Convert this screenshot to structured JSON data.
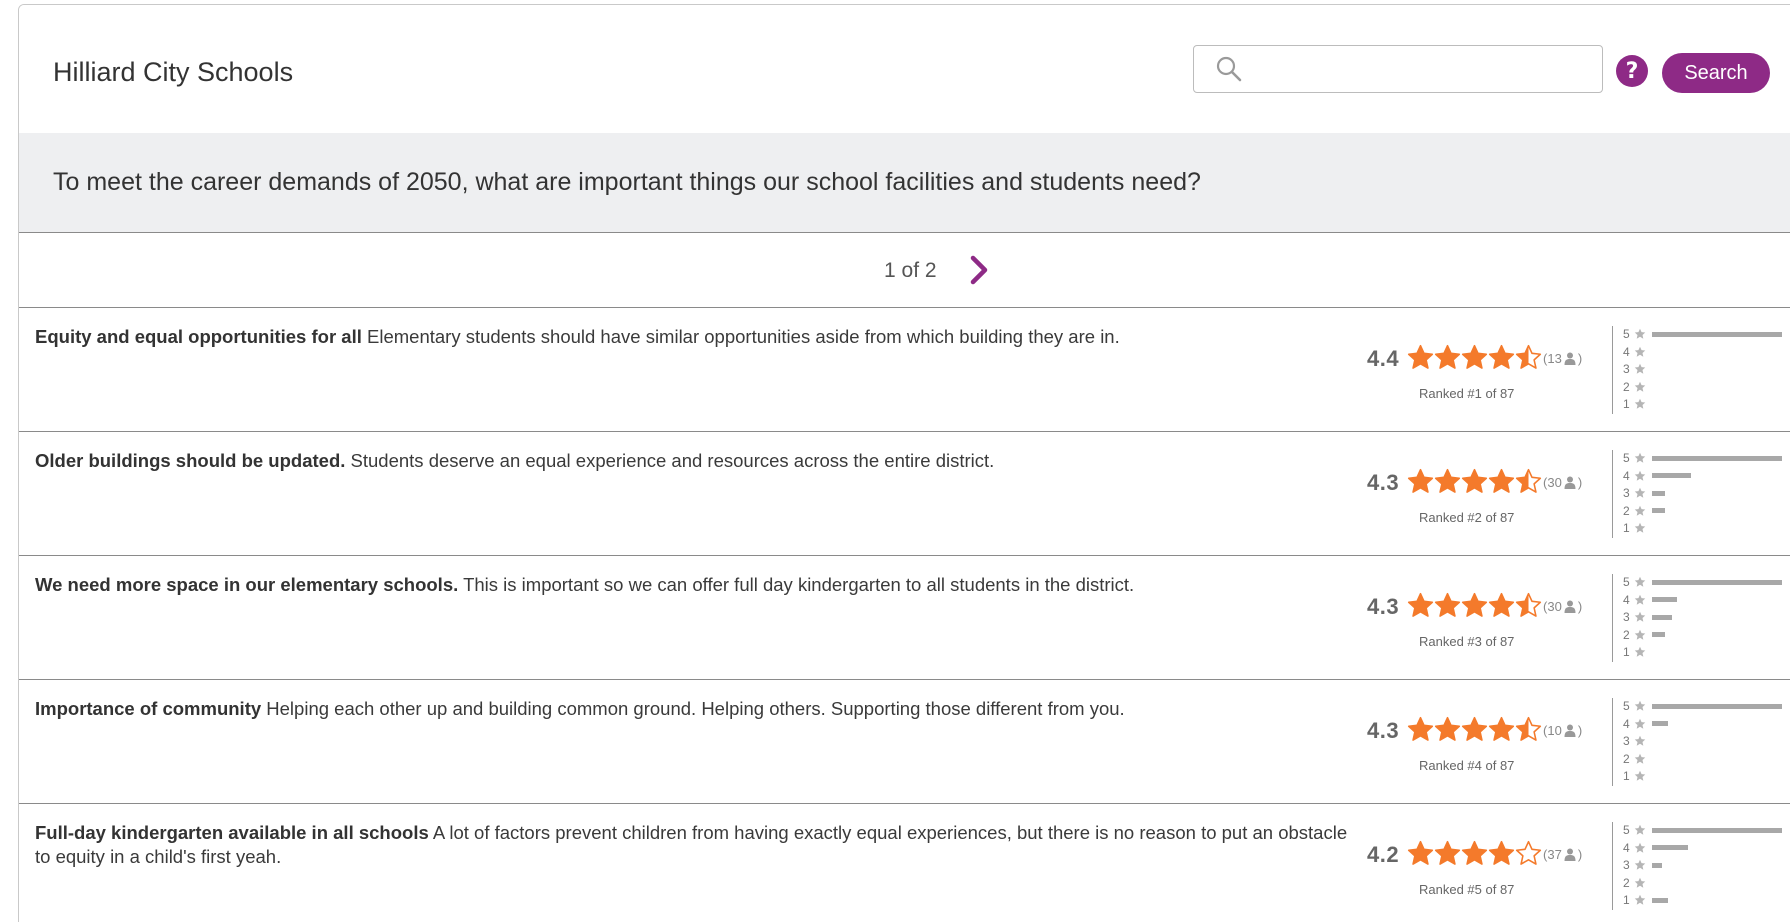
{
  "header": {
    "title": "Hilliard City Schools",
    "search_placeholder": "",
    "search_label": "Search",
    "help_label": "?"
  },
  "question": "To meet the career demands of 2050, what are important things our school facilities and students need?",
  "pager": {
    "label": "1 of 2"
  },
  "colors": {
    "accent": "#8e2a86",
    "star": "#f47a2b",
    "bar": "#a8a8a8"
  },
  "ideas": [
    {
      "title": "Equity and equal opportunities for all",
      "body": "Elementary students should have similar opportunities aside from which building they are in.",
      "score": "4.4",
      "stars": 4.5,
      "voters": "13",
      "ranked": "Ranked #1 of 87",
      "distribution": {
        "5": 1.0,
        "4": 0,
        "3": 0,
        "2": 0,
        "1": 0
      }
    },
    {
      "title": "Older buildings should be updated.",
      "body": "Students deserve an equal experience and resources across the entire district.",
      "score": "4.3",
      "stars": 4.5,
      "voters": "30",
      "ranked": "Ranked #2 of 87",
      "distribution": {
        "5": 1.0,
        "4": 0.3,
        "3": 0.1,
        "2": 0.1,
        "1": 0
      }
    },
    {
      "title": "We need more space in our elementary schools.",
      "body": "This is important so we can offer full day kindergarten to all students in the district.",
      "score": "4.3",
      "stars": 4.5,
      "voters": "30",
      "ranked": "Ranked #3 of 87",
      "distribution": {
        "5": 1.0,
        "4": 0.19,
        "3": 0.15,
        "2": 0.1,
        "1": 0
      }
    },
    {
      "title": "Importance of community",
      "body": "Helping each other up and building common ground. Helping others. Supporting those different from you.",
      "score": "4.3",
      "stars": 4.5,
      "voters": "10",
      "ranked": "Ranked #4 of 87",
      "distribution": {
        "5": 1.0,
        "4": 0.12,
        "3": 0,
        "2": 0,
        "1": 0
      }
    },
    {
      "title": "Full-day kindergarten available in all schools",
      "body": "A lot of factors prevent children from having exactly equal experiences, but there is no reason to put an obstacle to equity in a child's first yeah.",
      "score": "4.2",
      "stars": 4,
      "voters": "37",
      "ranked": "Ranked #5 of 87",
      "distribution": {
        "5": 1.0,
        "4": 0.28,
        "3": 0.08,
        "2": 0,
        "1": 0.12
      }
    }
  ]
}
